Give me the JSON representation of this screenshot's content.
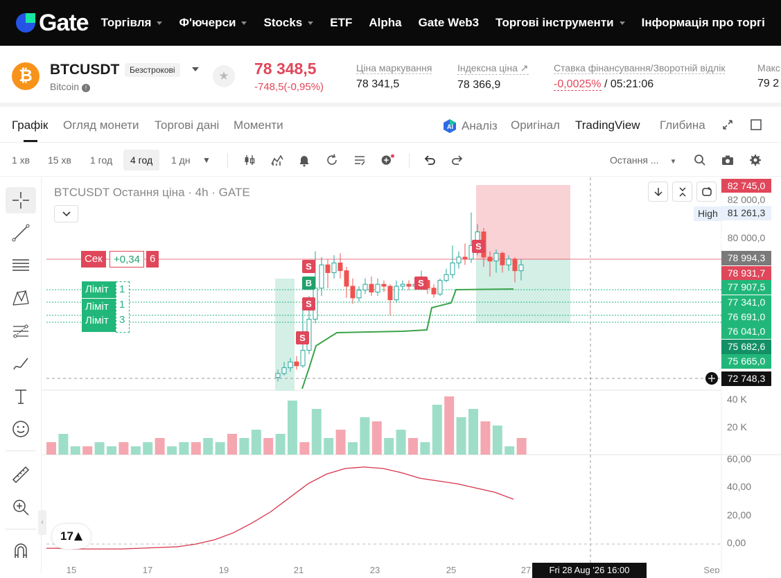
{
  "nav": {
    "logo": "Gate",
    "items": [
      {
        "label": "Торгівля",
        "caret": true
      },
      {
        "label": "Ф'ючерси",
        "caret": true
      },
      {
        "label": "Stocks",
        "caret": true
      },
      {
        "label": "ETF",
        "caret": false
      },
      {
        "label": "Alpha",
        "caret": false
      },
      {
        "label": "Gate Web3",
        "caret": false
      },
      {
        "label": "Торгові інструменти",
        "caret": true
      },
      {
        "label": "Інформація про торгі",
        "caret": false
      }
    ]
  },
  "ticker": {
    "symbol": "BTCUSDT",
    "contract_type": "Безстрокові",
    "coin_name": "Bitcoin",
    "coin_glyph": "₿",
    "last_price": "78 348,5",
    "change": "-748,5(-0,95%)",
    "mark_label": "Ціна маркування",
    "mark_value": "78 341,5",
    "index_label": "Індексна ціна ↗",
    "index_value": "78 366,9",
    "funding_label": "Ставка фінансування/Зворотній відлік",
    "funding_rate": "-0,0025%",
    "funding_countdown": " / 05:21:06",
    "max_label": "Макс",
    "max_value": "79 2"
  },
  "tabs": {
    "chart": "Графік",
    "overview": "Огляд монети",
    "trade_data": "Торгові дані",
    "moments": "Моменти",
    "analysis": "Аналіз",
    "original": "Оригінал",
    "tradingview": "TradingView",
    "depth": "Глибина"
  },
  "toolbar": {
    "timeframes": [
      "1 хв",
      "15 хв",
      "1 год",
      "4 год",
      "1 дн"
    ],
    "active_timeframe": "4 год",
    "price_type": "Остання ..."
  },
  "chart": {
    "legend": "BTCUSDT Остання ціна · 4h · GATE",
    "high_label": "High",
    "high_value": "81 261,3",
    "price_labels": [
      {
        "text": "82 745,0",
        "kind": "red"
      },
      {
        "text": "82 000,0",
        "kind": "plain"
      },
      {
        "text": "80 000,0",
        "kind": "plain"
      },
      {
        "text": "78 994,3",
        "kind": "gray"
      },
      {
        "text": "78 931,7",
        "kind": "red"
      },
      {
        "text": "77 907,5",
        "kind": "green"
      },
      {
        "text": "77 341,0",
        "kind": "green"
      },
      {
        "text": "76 691,0",
        "kind": "green"
      },
      {
        "text": "76 041,0",
        "kind": "green"
      },
      {
        "text": "75 682,6",
        "kind": "dgreen"
      },
      {
        "text": "75 665,0",
        "kind": "green"
      },
      {
        "text": "72 748,3",
        "kind": "black"
      }
    ],
    "order_sell": {
      "label": "Сек",
      "qty": "+0,34",
      "count": "6"
    },
    "order_limit": {
      "label": "Ліміт",
      "count": "1",
      "stacked_1": "Ліміт",
      "stacked_2": "Ліміт",
      "c2": "1",
      "c3": "3"
    },
    "signals": {
      "sell": "S",
      "buy": "B"
    },
    "volume_labels": [
      "40 K",
      "20 K"
    ],
    "osc_labels": [
      "60,00",
      "40,00",
      "20,00",
      "0,00"
    ],
    "x_labels": [
      "15",
      "17",
      "19",
      "21",
      "23",
      "25",
      "27",
      "Sep"
    ],
    "crosshair_time": "Fri 28 Aug '26  16:00",
    "tv_logo": "17",
    "colors": {
      "up": "#26a69a",
      "down": "#ef5350",
      "red_label": "#e0475a",
      "green_label": "#22b77a"
    }
  },
  "chart_data": {
    "type": "candlestick",
    "title": "BTCUSDT Остання ціна · 4h · GATE",
    "y_ticks": [
      82000,
      80000
    ],
    "x_ticks": [
      "15",
      "17",
      "19",
      "21",
      "23",
      "25",
      "27",
      "Sep"
    ],
    "candles": [
      {
        "o": 72800,
        "c": 73000,
        "h": 73200,
        "l": 72600
      },
      {
        "o": 73000,
        "c": 73300,
        "h": 73600,
        "l": 72900
      },
      {
        "o": 73300,
        "c": 73600,
        "h": 73800,
        "l": 73100
      },
      {
        "o": 73600,
        "c": 73400,
        "h": 73900,
        "l": 73200
      },
      {
        "o": 73400,
        "c": 74200,
        "h": 76300,
        "l": 73300
      },
      {
        "o": 74200,
        "c": 75800,
        "h": 77000,
        "l": 74000
      },
      {
        "o": 75800,
        "c": 77400,
        "h": 79300,
        "l": 75600
      },
      {
        "o": 77400,
        "c": 78600,
        "h": 79000,
        "l": 77000
      },
      {
        "o": 78600,
        "c": 78200,
        "h": 78900,
        "l": 77400
      },
      {
        "o": 78200,
        "c": 78700,
        "h": 79100,
        "l": 77900
      },
      {
        "o": 78700,
        "c": 78300,
        "h": 79200,
        "l": 77900
      },
      {
        "o": 78300,
        "c": 77500,
        "h": 78500,
        "l": 76900
      },
      {
        "o": 77500,
        "c": 76900,
        "h": 77900,
        "l": 76600
      },
      {
        "o": 76900,
        "c": 77300,
        "h": 77500,
        "l": 76700
      },
      {
        "o": 77300,
        "c": 77600,
        "h": 77900,
        "l": 77100
      },
      {
        "o": 77600,
        "c": 77200,
        "h": 78000,
        "l": 77000
      },
      {
        "o": 77200,
        "c": 77600,
        "h": 77900,
        "l": 77000
      },
      {
        "o": 77600,
        "c": 77500,
        "h": 77800,
        "l": 77200
      },
      {
        "o": 77500,
        "c": 76800,
        "h": 77600,
        "l": 76000
      },
      {
        "o": 76800,
        "c": 77500,
        "h": 77800,
        "l": 76700
      },
      {
        "o": 77500,
        "c": 77600,
        "h": 77800,
        "l": 77300
      },
      {
        "o": 77600,
        "c": 77500,
        "h": 77800,
        "l": 77300
      },
      {
        "o": 77500,
        "c": 77600,
        "h": 77800,
        "l": 77300
      },
      {
        "o": 77600,
        "c": 77800,
        "h": 78300,
        "l": 77500
      },
      {
        "o": 77800,
        "c": 77400,
        "h": 77900,
        "l": 77100
      },
      {
        "o": 77400,
        "c": 77100,
        "h": 77600,
        "l": 76900
      },
      {
        "o": 77100,
        "c": 77800,
        "h": 77900,
        "l": 77000
      },
      {
        "o": 77800,
        "c": 78100,
        "h": 78400,
        "l": 77700
      },
      {
        "o": 78100,
        "c": 78700,
        "h": 79600,
        "l": 77900
      },
      {
        "o": 78700,
        "c": 79000,
        "h": 79300,
        "l": 78400
      },
      {
        "o": 79000,
        "c": 78900,
        "h": 79700,
        "l": 78600
      },
      {
        "o": 78900,
        "c": 79600,
        "h": 81300,
        "l": 78700
      },
      {
        "o": 79600,
        "c": 80300,
        "h": 80700,
        "l": 79100
      },
      {
        "o": 80300,
        "c": 79000,
        "h": 80500,
        "l": 78500
      },
      {
        "o": 79000,
        "c": 78800,
        "h": 79300,
        "l": 78000
      },
      {
        "o": 78800,
        "c": 79200,
        "h": 79400,
        "l": 78200
      },
      {
        "o": 79200,
        "c": 78600,
        "h": 79300,
        "l": 78200
      },
      {
        "o": 78600,
        "c": 78900,
        "h": 79100,
        "l": 78300
      },
      {
        "o": 78900,
        "c": 78300,
        "h": 79000,
        "l": 77700
      },
      {
        "o": 78300,
        "c": 78600,
        "h": 78900,
        "l": 77800
      }
    ],
    "volume": [
      3,
      5,
      2,
      2,
      3,
      2,
      3,
      2,
      3,
      4,
      2,
      3,
      3,
      4,
      3,
      5,
      4,
      6,
      4,
      5,
      13,
      3,
      11,
      4,
      6,
      3,
      9,
      8,
      4,
      6,
      4,
      3,
      12,
      14,
      9,
      11,
      8,
      7,
      2,
      4
    ],
    "oscillator": [
      -3,
      -3,
      -3.5,
      -3.5,
      -3.5,
      -3,
      -2.5,
      -2,
      0,
      3,
      8,
      15,
      23,
      33,
      43,
      50,
      54,
      55,
      54,
      51,
      47,
      45,
      43,
      40,
      37,
      32
    ]
  }
}
